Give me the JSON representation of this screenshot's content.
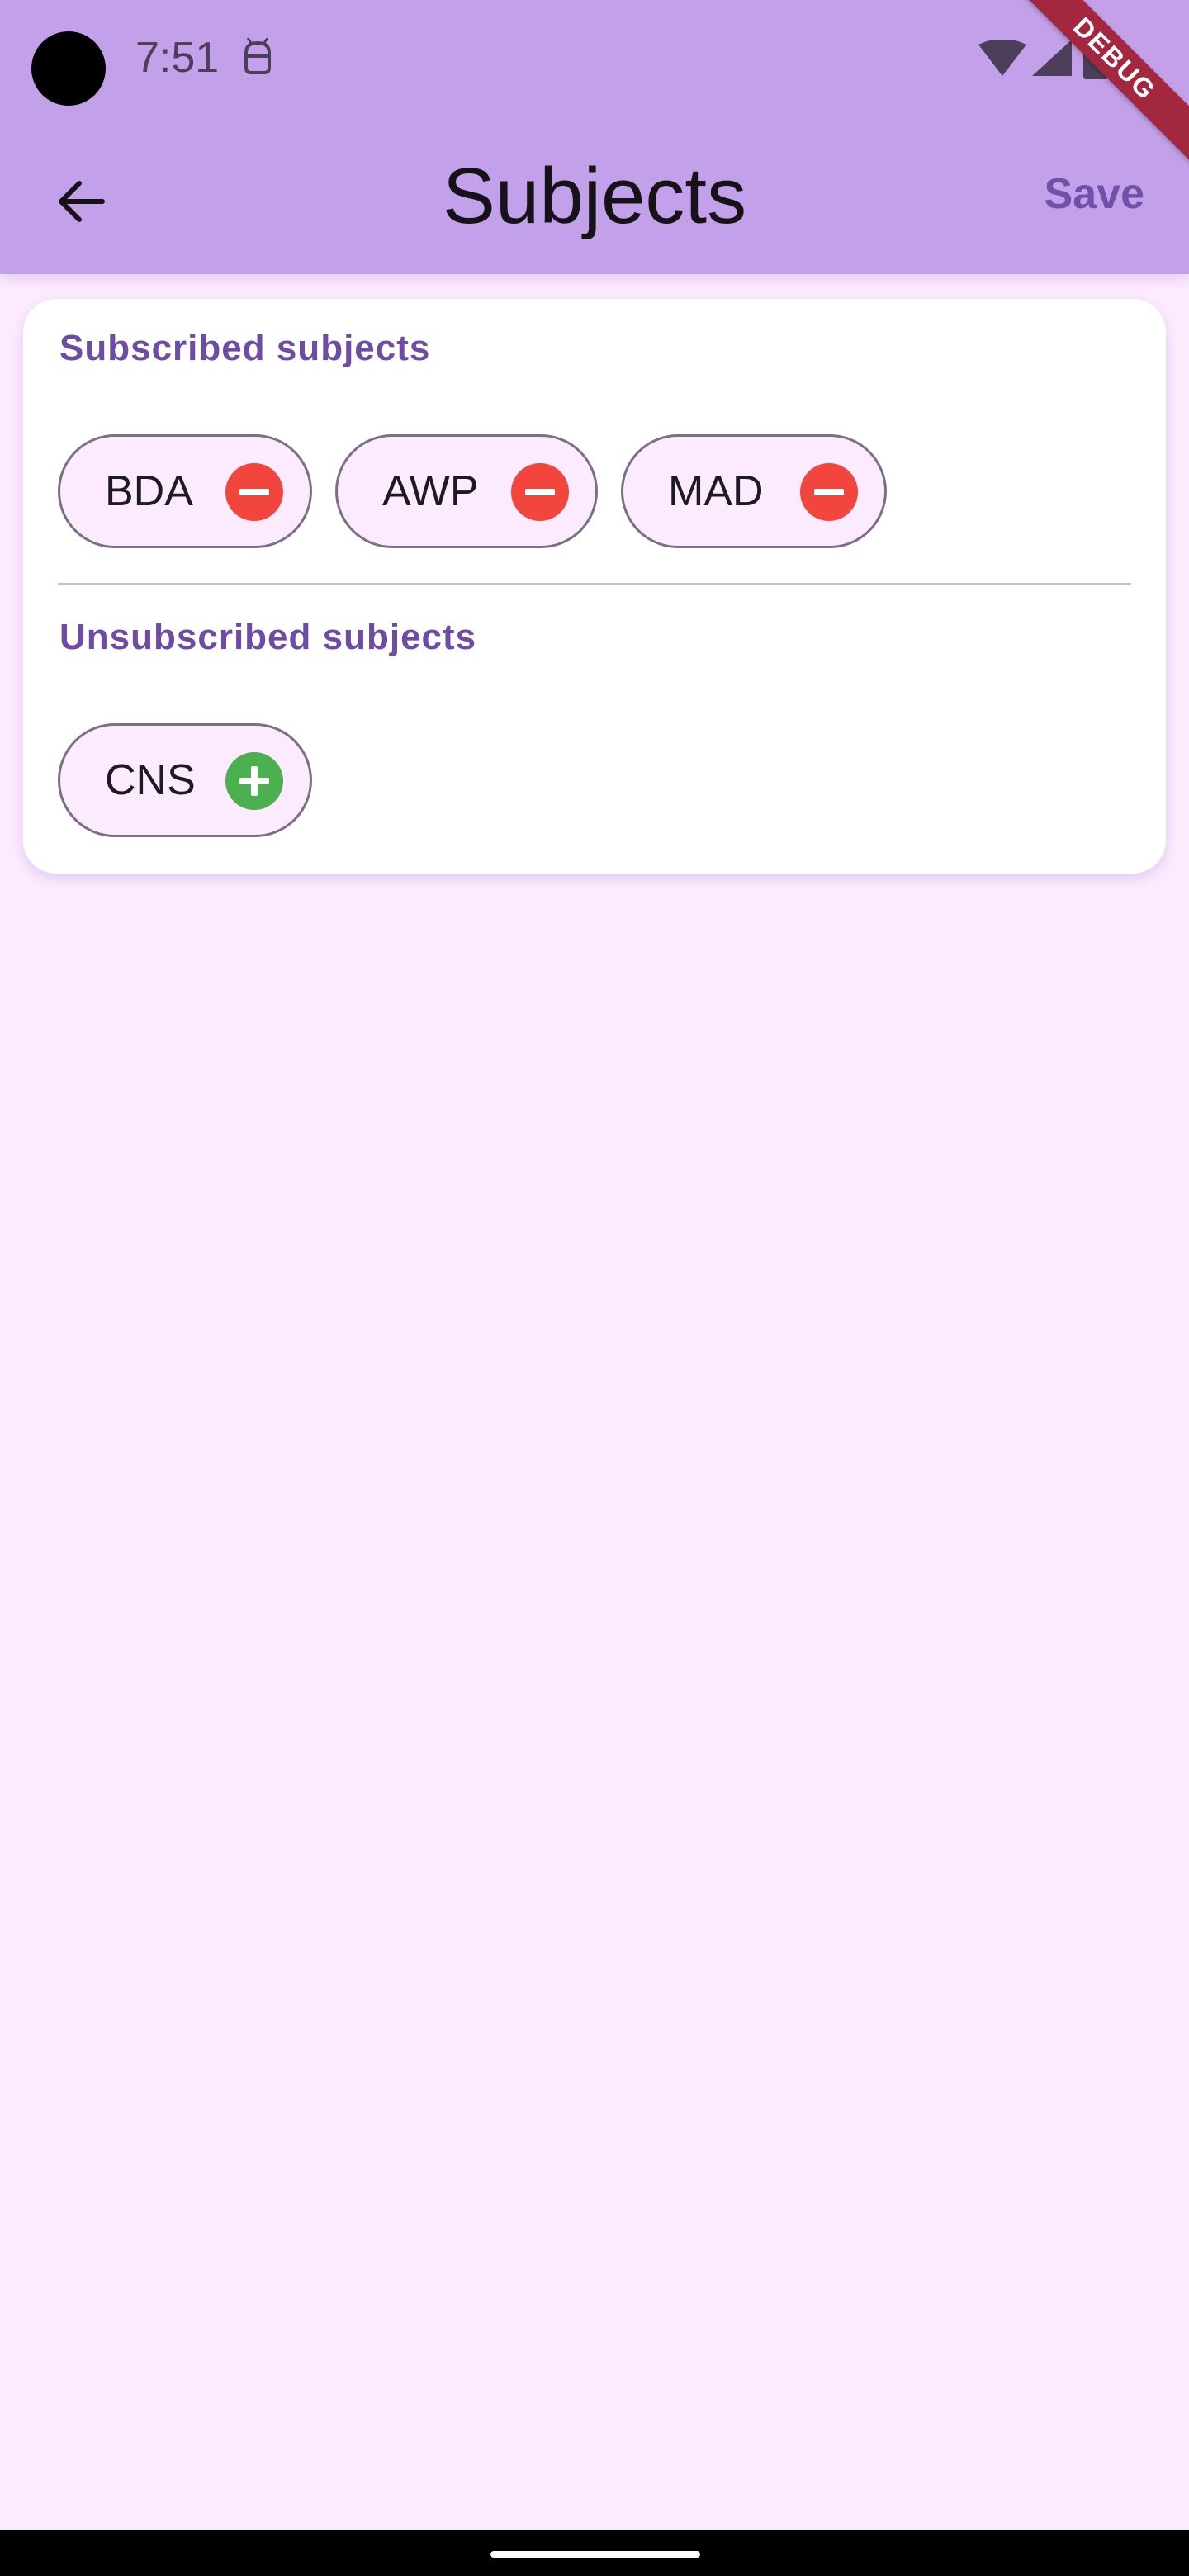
{
  "status_bar": {
    "time": "7:51",
    "icons": [
      "camera-cutout",
      "android-icon",
      "wifi-icon",
      "signal-icon",
      "battery-icon"
    ]
  },
  "debug_banner": "DEBUG",
  "app_bar": {
    "back_icon": "arrow-left-icon",
    "title": "Subjects",
    "save_label": "Save"
  },
  "subscribed": {
    "heading": "Subscribed subjects",
    "chips": [
      {
        "label": "BDA",
        "icon": "remove-circle-icon"
      },
      {
        "label": "AWP",
        "icon": "remove-circle-icon"
      },
      {
        "label": "MAD",
        "icon": "remove-circle-icon"
      }
    ]
  },
  "unsubscribed": {
    "heading": "Unsubscribed subjects",
    "chips": [
      {
        "label": "CNS",
        "icon": "add-circle-icon"
      }
    ]
  },
  "colors": {
    "app_bar": "#C3A1EA",
    "background": "#FCEBFF",
    "accent": "#6E52A8",
    "remove": "#F1453D",
    "add": "#4CAF50"
  }
}
